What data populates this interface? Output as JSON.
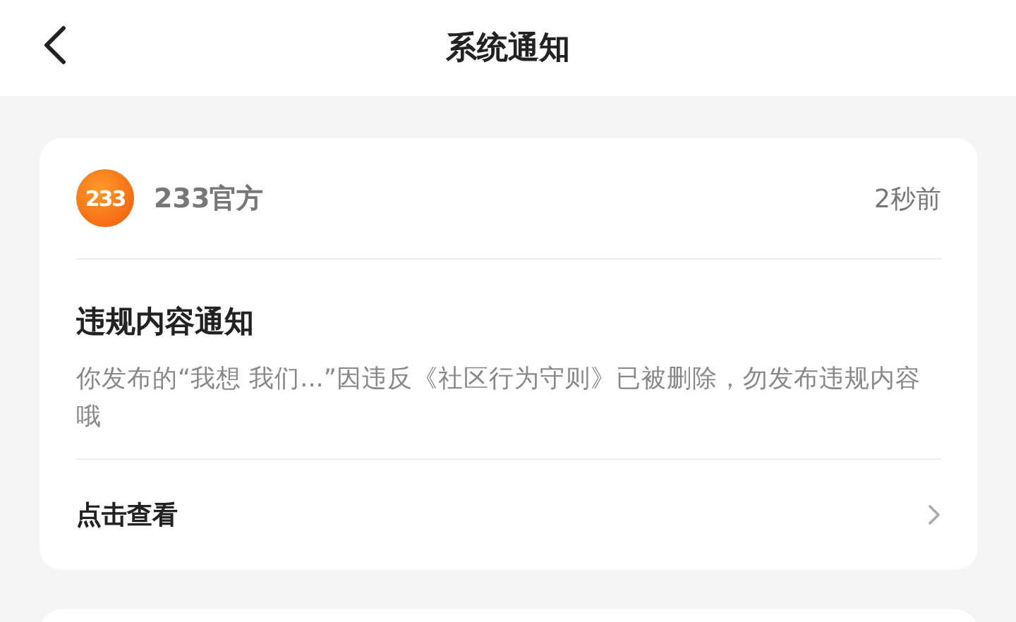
{
  "header": {
    "title": "系统通知"
  },
  "notifications": [
    {
      "logo_text": "233",
      "sender": "233官方",
      "time": "2秒前",
      "title": "违规内容通知",
      "body": "你发布的“我想 我们...”因违反《社区行为守则》已被删除，勿发布违规内容哦",
      "action": "点击查看"
    }
  ]
}
